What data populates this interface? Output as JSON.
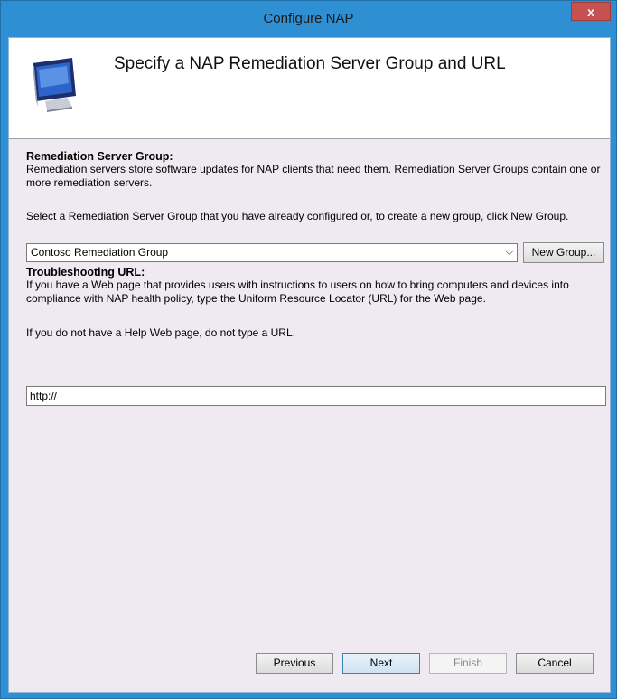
{
  "window": {
    "title": "Configure NAP",
    "close_label": "x"
  },
  "header": {
    "title": "Specify a NAP Remediation Server Group and URL"
  },
  "remediation": {
    "heading": "Remediation Server Group:",
    "description": "Remediation servers store software updates for NAP clients that need them. Remediation Server Groups contain one or more remediation servers.",
    "instruction": "Select a Remediation Server Group that you have already configured or, to create a new group, click New Group.",
    "selected_group": "Contoso Remediation Group",
    "new_group_label": "New Group..."
  },
  "troubleshooting": {
    "heading": "Troubleshooting URL:",
    "description": "If you have a Web page that provides users with instructions to users on how to bring computers and devices into compliance with NAP health policy, type the Uniform Resource Locator (URL) for the Web page.",
    "note": "If you do not have a Help Web page, do not type a URL.",
    "url_value": "http://"
  },
  "buttons": {
    "previous": "Previous",
    "next": "Next",
    "finish": "Finish",
    "cancel": "Cancel"
  }
}
